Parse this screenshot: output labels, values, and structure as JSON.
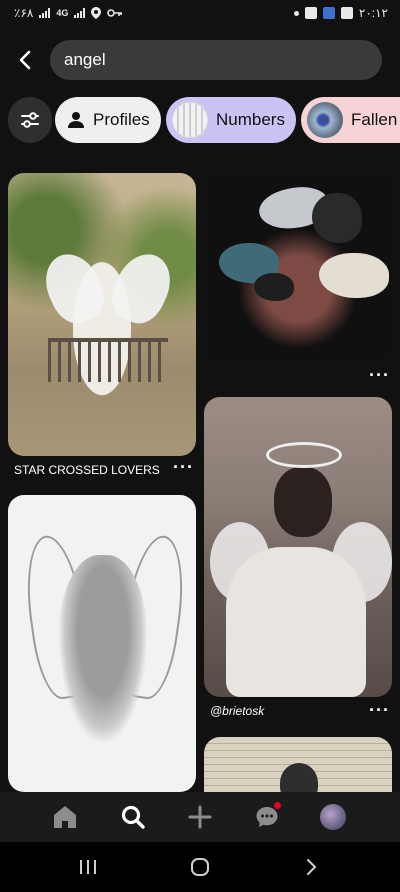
{
  "status_bar": {
    "left_text": "٪۶۸",
    "network": "4G",
    "time": "۲۰:۱۲"
  },
  "search": {
    "query": "angel"
  },
  "chips": [
    {
      "label": "Profiles"
    },
    {
      "label": "Numbers"
    },
    {
      "label": "Fallen"
    }
  ],
  "pins": {
    "pin1_caption": "STAR CROSSED LOVERS",
    "pin3_caption": "@brietosk"
  },
  "icons": {
    "back": "chevron-left-icon",
    "filter": "sliders-icon",
    "profile": "person-icon",
    "home": "home-icon",
    "search": "search-icon",
    "create": "plus-icon",
    "messages": "chat-icon",
    "more": "ellipsis-icon"
  },
  "colors": {
    "background": "#111111",
    "search_field": "#3a3a3a",
    "chip_profiles": "#efefef",
    "chip_numbers": "#c9c4f4",
    "chip_fallen": "#f6d4d6",
    "notification": "#e60023"
  }
}
